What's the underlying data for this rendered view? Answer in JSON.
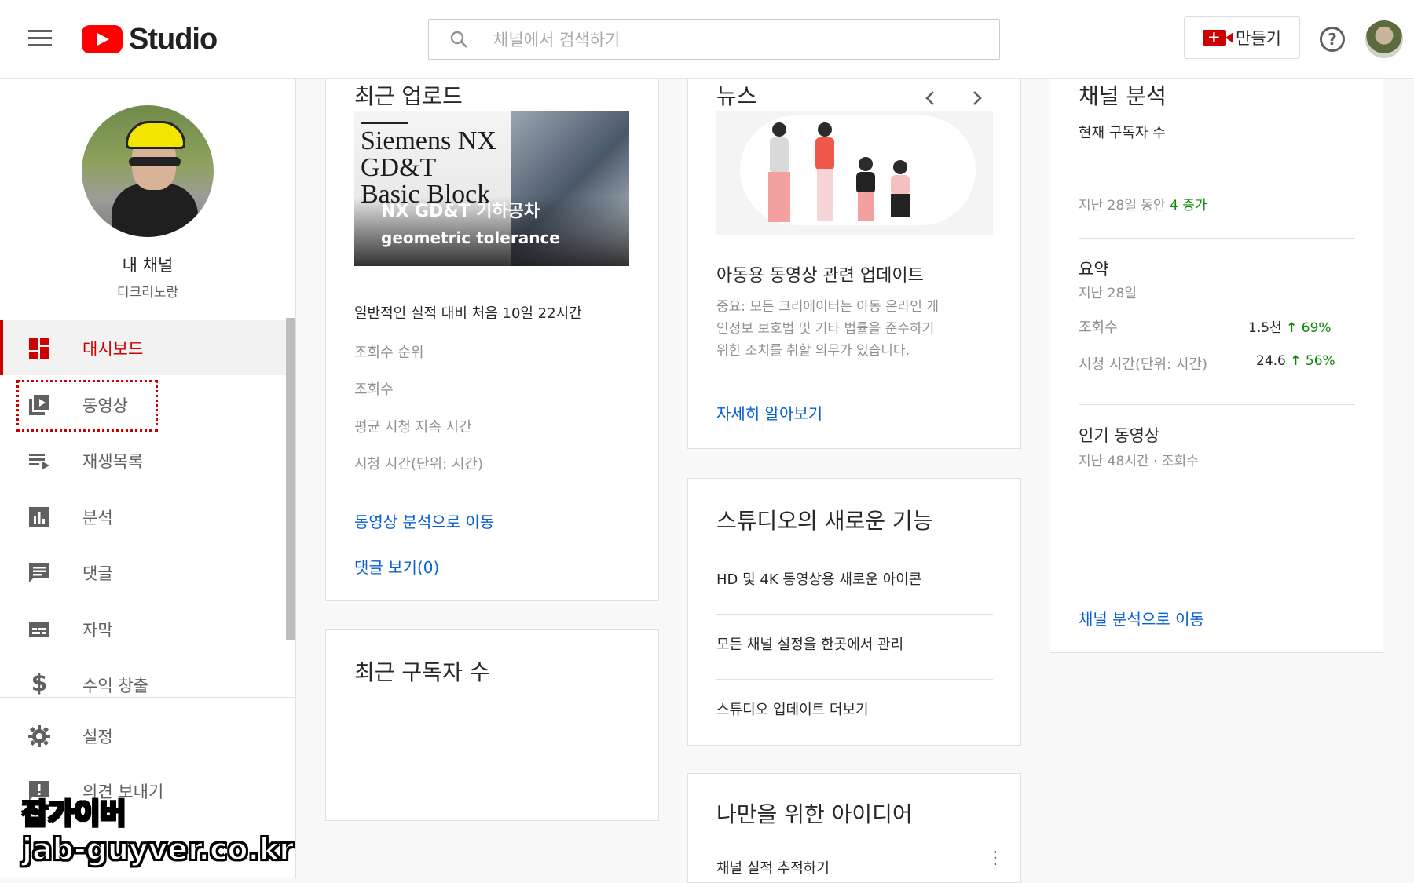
{
  "header": {
    "logo_text": "Studio",
    "search_placeholder": "채널에서 검색하기",
    "create_label": "만들기"
  },
  "sidebar": {
    "channel_name": "내 채널",
    "channel_handle": "디크리노랑",
    "items": [
      {
        "label": "대시보드",
        "icon": "dashboard-icon",
        "active": true
      },
      {
        "label": "동영상",
        "icon": "video-library-icon"
      },
      {
        "label": "재생목록",
        "icon": "playlist-icon"
      },
      {
        "label": "분석",
        "icon": "analytics-icon"
      },
      {
        "label": "댓글",
        "icon": "comments-icon"
      },
      {
        "label": "자막",
        "icon": "subtitles-icon"
      },
      {
        "label": "수익 창출",
        "icon": "dollar-icon"
      },
      {
        "label": "설정",
        "icon": "gear-icon"
      },
      {
        "label": "의견 보내기",
        "icon": "feedback-icon"
      }
    ]
  },
  "recent_upload": {
    "title": "최근 업로드",
    "thumb_line1": "Siemens NX",
    "thumb_line2": "GD&T",
    "thumb_line3": "Basic Block",
    "thumb_overlay1": "NX GD&T 기하공차",
    "thumb_overlay2": "geometric tolerance",
    "summary": "일반적인 실적 대비 처음 10일 22시간",
    "metrics": [
      "조회수 순위",
      "조회수",
      "평균 시청 지속 시간",
      "시청 시간(단위: 시간)"
    ],
    "link_analytics": "동영상 분석으로 이동",
    "link_comments": "댓글 보기(0)"
  },
  "recent_subscribers": {
    "title": "최근 구독자 수"
  },
  "news": {
    "title": "뉴스",
    "headline": "아동용 동영상 관련 업데이트",
    "body_line1": "중요: 모든 크리에이터는 아동 온라인 개",
    "body_line2": "인정보 보호법 및 기타 법률을 준수하기",
    "body_line3": "위한 조치를 취할 의무가 있습니다.",
    "link": "자세히 알아보기"
  },
  "whats_new": {
    "title": "스튜디오의 새로운 기능",
    "items": [
      "HD 및 4K 동영상용 새로운 아이콘",
      "모든 채널 설정을 한곳에서 관리",
      "스튜디오 업데이트 더보기"
    ]
  },
  "ideas": {
    "title": "나만을 위한 아이디어",
    "item": "채널 실적 추적하기"
  },
  "channel_analytics": {
    "title": "채널 분석",
    "current_subs_label": "현재 구독자 수",
    "period_text": "지난 28일 동안",
    "period_change": "4 증가",
    "summary_title": "요약",
    "summary_period": "지난 28일",
    "views_label": "조회수",
    "views_value": "1.5천",
    "views_change": "69%",
    "watch_label": "시청 시간(단위: 시간)",
    "watch_value": "24.6",
    "watch_change": "56%",
    "top_videos_title": "인기 동영상",
    "top_videos_sub": "지난 48시간 · 조회수",
    "link": "채널 분석으로 이동"
  },
  "watermark": {
    "line1": "잡가이버",
    "line2": "jab-guyver.co.kr"
  },
  "colors": {
    "accent": "#cc0000",
    "link": "#065fd4",
    "positive": "#0a8a00"
  }
}
